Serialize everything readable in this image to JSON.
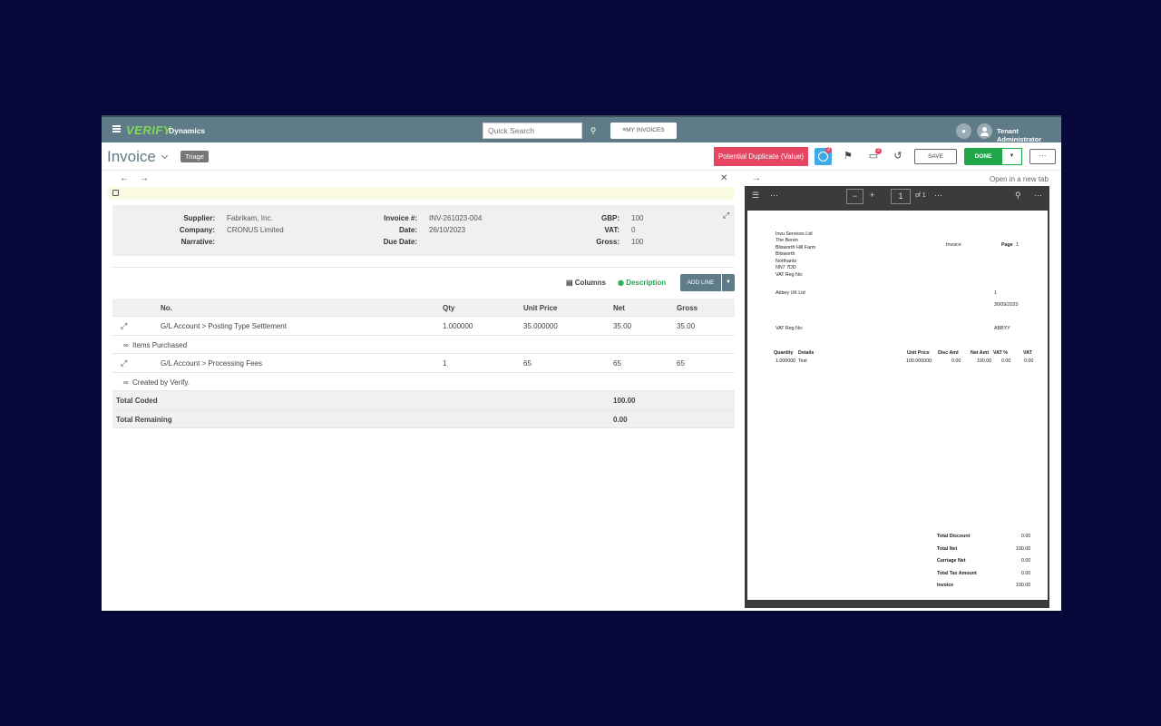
{
  "topbar": {
    "brand": "VERIFY",
    "brand_sub": "Dynamics",
    "search_placeholder": "Quick Search",
    "my_invoices_label": "MY INVOICES",
    "user_name": "Tenant Administrator"
  },
  "header": {
    "title": "Invoice",
    "status": "Triage",
    "duplicate_label": "Potential Duplicate (Value)",
    "clock_badge": "2",
    "notes_badge": "2",
    "save_label": "SAVE",
    "done_label": "DONE",
    "more_label": "···"
  },
  "summary": {
    "supplier_label": "Supplier:",
    "supplier": "Fabrikam, Inc.",
    "company_label": "Company:",
    "company": "CRONUS Limited",
    "narrative_label": "Narrative:",
    "narrative": "",
    "invoice_no_label": "Invoice #:",
    "invoice_no": "INV-261023-004",
    "date_label": "Date:",
    "date": "26/10/2023",
    "due_date_label": "Due Date:",
    "due_date": "",
    "gbp_label": "GBP:",
    "gbp": "100",
    "vat_label": "VAT:",
    "vat": "0",
    "gross_label": "Gross:",
    "gross": "100"
  },
  "toolbar": {
    "columns_label": "Columns",
    "description_label": "Description",
    "add_line_label": "ADD LINE"
  },
  "table": {
    "headers": {
      "no": "No.",
      "qty": "Qty",
      "unit_price": "Unit Price",
      "net": "Net",
      "gross": "Gross"
    },
    "rows": [
      {
        "no": "G/L Account > Posting Type Settlement",
        "qty": "1.000000",
        "unit_price": "35.000000",
        "net": "35.00",
        "gross": "35.00",
        "note": "Items Purchased"
      },
      {
        "no": "G/L Account > Processing Fees",
        "qty": "1",
        "unit_price": "65",
        "net": "65",
        "gross": "65",
        "note": "Created by Verify."
      }
    ],
    "total_coded_label": "Total Coded",
    "total_coded": "100.00",
    "total_remaining_label": "Total Remaining",
    "total_remaining": "0.00"
  },
  "viewer": {
    "open_new_tab": "Open in a new tab",
    "page_number": "1",
    "page_of": "of 1",
    "pdf": {
      "address": [
        "Invu Services Ltd",
        "The Beren",
        "Blisworth Hill Farm",
        "Blisworth",
        "Northants",
        "NN7 7DD",
        "VAT Reg No:"
      ],
      "doc_title": "Invoice",
      "page_label": "Page",
      "page_value": "1",
      "customer": "Abbey UK Ltd",
      "ref": "1",
      "date": "30/09/2020",
      "vat_reg_label": "VAT Reg No:",
      "account": "ABBYY",
      "line_headers": {
        "quantity": "Quantity",
        "details": "Details",
        "unit_price": "Unit Price",
        "disc_amt": "Disc Amt",
        "net_amt": "Net Amt",
        "vat_pct": "VAT %",
        "vat": "VAT"
      },
      "line": {
        "quantity": "1.000000",
        "details": "Test",
        "unit_price": "100.000000",
        "disc_amt": "0.00",
        "net_amt": "100.00",
        "vat_pct": "0.00",
        "vat": "0.00"
      },
      "totals": [
        {
          "label": "Total Discount",
          "value": "0.00"
        },
        {
          "label": "Total Net",
          "value": "100.00"
        },
        {
          "label": "Carriage Net",
          "value": "0.00"
        },
        {
          "label": "Total Tax Amount",
          "value": "0.00"
        },
        {
          "label": "Invoice",
          "value": "100.00"
        }
      ]
    }
  }
}
